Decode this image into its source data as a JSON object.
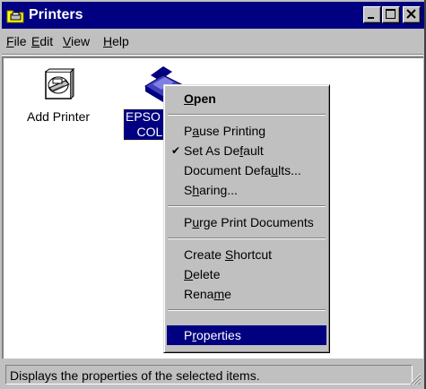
{
  "window": {
    "title": "Printers",
    "icon": "printers-folder-icon",
    "controls": [
      "minimize",
      "maximize",
      "close"
    ]
  },
  "menubar": [
    {
      "label": "File",
      "mnemonic": "F"
    },
    {
      "label": "Edit",
      "mnemonic": "E"
    },
    {
      "label": "View",
      "mnemonic": "V"
    },
    {
      "label": "Help",
      "mnemonic": "H"
    }
  ],
  "icons": [
    {
      "label": "Add Printer",
      "icon": "add-printer-icon"
    },
    {
      "label_lines": [
        "EPSO",
        "COL("
      ],
      "icon": "epson-printer-icon",
      "selected": true
    }
  ],
  "context_menu": {
    "items": [
      {
        "label": "Open",
        "default": true
      },
      {
        "label": "Pause Printing"
      },
      {
        "label": "Set As Default",
        "checked": true
      },
      {
        "label": "Document Defaults..."
      },
      {
        "label": "Sharing..."
      },
      {
        "label": "Purge Print Documents"
      },
      {
        "label": "Create Shortcut"
      },
      {
        "label": "Delete"
      },
      {
        "label": "Rename"
      },
      {
        "label": "Properties",
        "selected": true
      }
    ],
    "check_glyph": "✔"
  },
  "statusbar": {
    "text": "Displays the properties of the selected items."
  },
  "colors": {
    "titlebar": "#000080",
    "selection": "#000080",
    "face": "#c0c0c0"
  }
}
